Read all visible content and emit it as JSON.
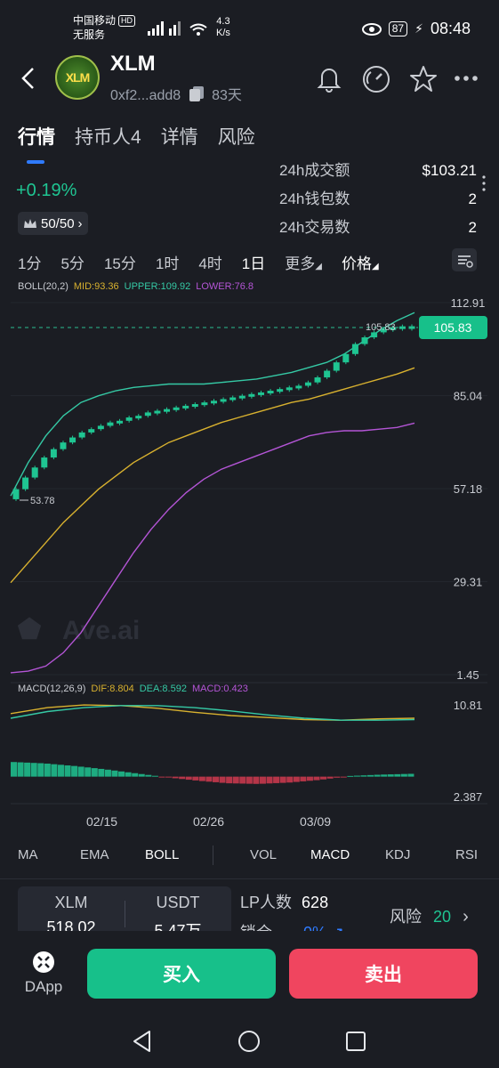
{
  "status_bar": {
    "carrier": "中国移动",
    "hd": "HD",
    "service": "无服务",
    "net_speed_value": "4.3",
    "net_speed_unit": "K/s",
    "battery": "87",
    "time": "08:48"
  },
  "header": {
    "logo_text": "XLM",
    "title": "XLM",
    "address": "0xf2...add8",
    "age": "83天"
  },
  "tabs": [
    "行情",
    "持币人4",
    "详情",
    "风险"
  ],
  "price": {
    "change": "+0.19%",
    "rank": "50/50"
  },
  "stats": [
    {
      "label": "24h成交额",
      "value": "$103.21"
    },
    {
      "label": "24h钱包数",
      "value": "2"
    },
    {
      "label": "24h交易数",
      "value": "2"
    }
  ],
  "timeframes": [
    "1分",
    "5分",
    "15分",
    "1时",
    "4时",
    "1日",
    "更多",
    "价格"
  ],
  "active_timeframe": "1日",
  "boll_legend": {
    "name": "BOLL(20,2)",
    "mid": "MID:93.36",
    "upper": "UPPER:109.92",
    "lower": "LOWER:76.8"
  },
  "macd_legend": {
    "name": "MACD(12,26,9)",
    "dif": "DIF:8.804",
    "dea": "DEA:8.592",
    "macd": "MACD:0.423"
  },
  "price_axis": [
    "112.91",
    "85.04",
    "57.18",
    "29.31",
    "1.45"
  ],
  "macd_axis": [
    "10.81",
    "2.387"
  ],
  "current_price": "105.83",
  "last_marker": "105.83",
  "low_marker": "53.78",
  "watermark": "Ave.ai",
  "dates": [
    "02/15",
    "02/26",
    "03/09"
  ],
  "indicator_tabs": [
    "MA",
    "EMA",
    "BOLL",
    "VOL",
    "MACD",
    "KDJ",
    "RSI"
  ],
  "pool": {
    "token_a_label": "XLM",
    "token_a_amount": "518.02",
    "token_b_label": "USDT",
    "token_b_amount": "5.47万"
  },
  "lp": {
    "holders_label": "LP人数",
    "holders_value": "628",
    "lock_label": "锁仓",
    "lock_value": "0%"
  },
  "risk": {
    "label": "风险",
    "value": "20"
  },
  "buttons": {
    "dapp": "DApp",
    "buy": "买入",
    "sell": "卖出"
  },
  "colors": {
    "background": "#1b1d23",
    "up": "#1fc592",
    "down": "#d0394f",
    "mid_line": "#d8b12f",
    "upper_line": "#35c9a5",
    "lower_line": "#b455d6",
    "accent_blue": "#2f7bff"
  },
  "chart_data": {
    "type": "candlestick",
    "x_labels": [
      "02/15",
      "02/26",
      "03/09"
    ],
    "ylim": [
      1.45,
      112.91
    ],
    "candles_close": [
      57.0,
      60.5,
      63.5,
      66.5,
      69.0,
      71.0,
      72.5,
      74.0,
      75.0,
      76.0,
      77.0,
      77.5,
      78.5,
      79.0,
      80.0,
      80.5,
      81.0,
      81.5,
      82.0,
      82.5,
      83.0,
      83.5,
      84.0,
      84.5,
      85.0,
      85.5,
      86.0,
      86.5,
      87.0,
      87.5,
      88.0,
      89.0,
      90.5,
      92.5,
      95.0,
      97.5,
      100.5,
      102.5,
      104.0,
      105.0,
      105.5,
      105.8,
      105.83
    ],
    "boll_mid": [
      29.0,
      35.0,
      41.0,
      47.0,
      52.0,
      57.0,
      61.0,
      65.0,
      68.0,
      71.0,
      73.0,
      75.0,
      77.0,
      78.5,
      80.0,
      81.5,
      83.0,
      84.0,
      85.5,
      87.0,
      88.5,
      90.0,
      91.5,
      93.36
    ],
    "boll_upper": [
      55.0,
      65.0,
      73.0,
      79.0,
      83.0,
      85.0,
      86.5,
      87.5,
      88.0,
      88.5,
      88.5,
      88.5,
      89.0,
      89.5,
      90.0,
      91.0,
      92.0,
      93.5,
      95.0,
      97.5,
      101.0,
      104.5,
      107.5,
      109.92
    ],
    "boll_lower": [
      2.0,
      2.5,
      4.0,
      8.0,
      14.0,
      22.0,
      30.0,
      38.0,
      45.0,
      51.0,
      56.0,
      60.0,
      63.0,
      65.0,
      67.0,
      69.0,
      71.0,
      73.0,
      74.0,
      74.5,
      74.5,
      75.0,
      75.5,
      76.8
    ],
    "macd_dif": [
      9.5,
      10.4,
      10.8,
      10.7,
      10.3,
      9.7,
      9.2,
      8.9,
      8.6,
      8.5,
      8.7,
      8.804
    ],
    "macd_dea": [
      8.8,
      9.8,
      10.4,
      10.7,
      10.7,
      10.4,
      9.9,
      9.3,
      8.8,
      8.5,
      8.5,
      8.592
    ],
    "macd_hist": [
      2.2,
      2.0,
      1.6,
      1.1,
      0.5,
      -0.1,
      -0.6,
      -1.0,
      -1.1,
      -0.9,
      -0.5,
      0.1,
      0.3,
      0.423
    ]
  }
}
